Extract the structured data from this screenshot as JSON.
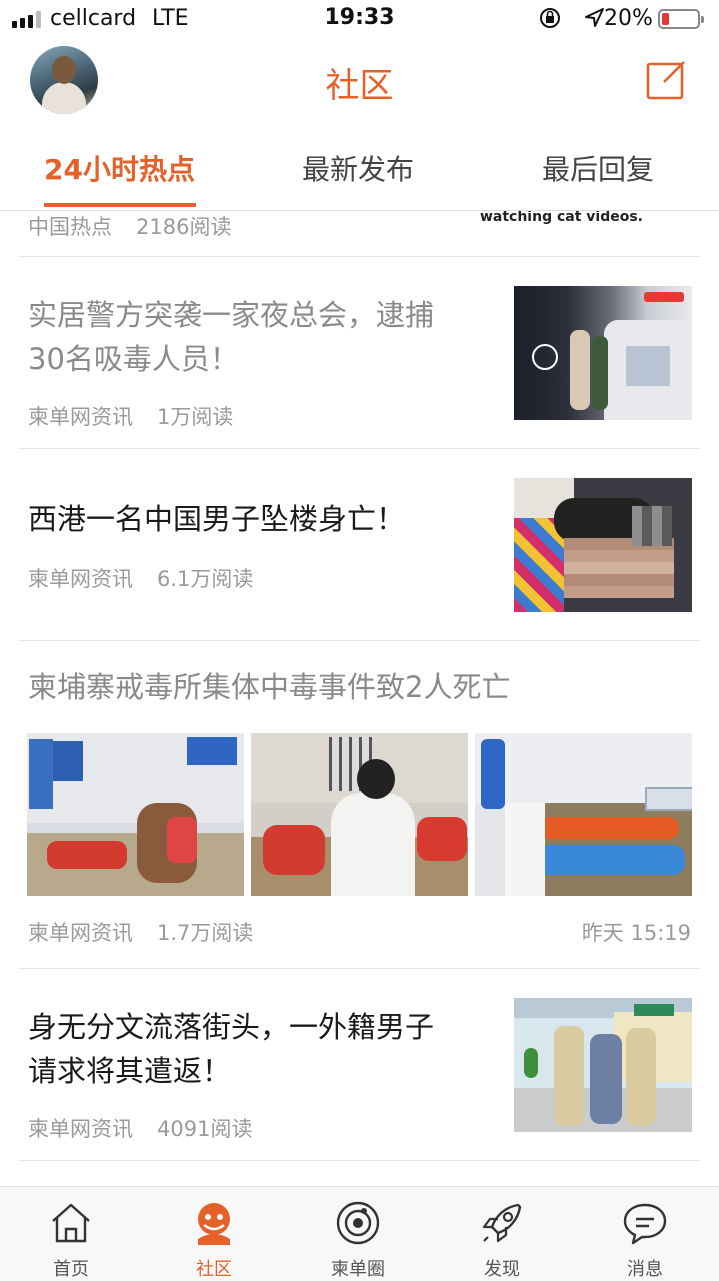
{
  "status_bar": {
    "carrier": "cellcard",
    "network": "LTE",
    "time": "19:33",
    "battery": "20%",
    "battery_level": 0.2,
    "icons": [
      "orientation-lock-icon",
      "location-arrow-icon"
    ]
  },
  "header": {
    "title": "社区",
    "compose_icon": "compose-icon",
    "accent_color": "#e4622a"
  },
  "tabs": [
    {
      "label": "24小时热点",
      "active": true
    },
    {
      "label": "最新发布",
      "active": false
    },
    {
      "label": "最后回复",
      "active": false
    }
  ],
  "feed": {
    "partial_item": {
      "source": "中国热点",
      "views": "2186阅读",
      "image_text": "watching cat videos."
    },
    "items": [
      {
        "title": "实居警方突袭一家夜总会，逮捕30名吸毒人员！",
        "title_lines": [
          "实居警方突袭一家夜总会，逮捕",
          "30名吸毒人员！"
        ],
        "source": "柬单网资讯",
        "views": "1万阅读",
        "read": true
      },
      {
        "title": "西港一名中国男子坠楼身亡！",
        "source": "柬单网资讯",
        "views": "6.1万阅读",
        "read": false
      },
      {
        "title": "柬埔寨戒毒所集体中毒事件致2人死亡",
        "source": "柬单网资讯",
        "views": "1.7万阅读",
        "time": "昨天 15:19",
        "read": true
      },
      {
        "title": "身无分文流落街头，一外籍男子请求将其遣返！",
        "title_lines": [
          "身无分文流落街头，一外籍男子",
          "请求将其遣返！"
        ],
        "source": "柬单网资讯",
        "views": "4091阅读",
        "read": false
      }
    ]
  },
  "tab_bar": [
    {
      "label": "首页",
      "icon": "home-icon",
      "active": false
    },
    {
      "label": "社区",
      "icon": "community-icon",
      "active": true
    },
    {
      "label": "柬单圈",
      "icon": "circle-icon",
      "active": false
    },
    {
      "label": "发现",
      "icon": "rocket-icon",
      "active": false
    },
    {
      "label": "消息",
      "icon": "message-icon",
      "active": false
    }
  ]
}
